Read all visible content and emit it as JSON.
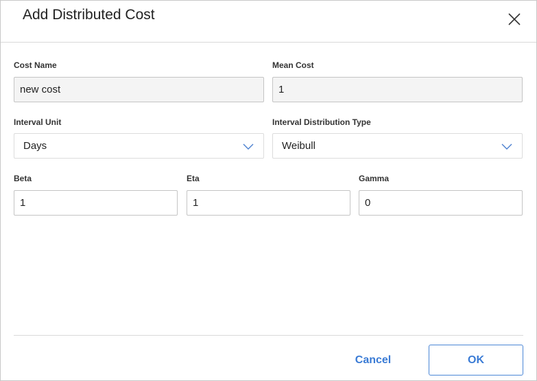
{
  "dialog": {
    "title": "Add Distributed Cost"
  },
  "fields": {
    "cost_name": {
      "label": "Cost Name",
      "value": "new cost"
    },
    "mean_cost": {
      "label": "Mean Cost",
      "value": "1"
    },
    "interval_unit": {
      "label": "Interval Unit",
      "value": "Days"
    },
    "interval_distribution_type": {
      "label": "Interval Distribution Type",
      "value": "Weibull"
    },
    "beta": {
      "label": "Beta",
      "value": "1"
    },
    "eta": {
      "label": "Eta",
      "value": "1"
    },
    "gamma": {
      "label": "Gamma",
      "value": "0"
    }
  },
  "footer": {
    "cancel_label": "Cancel",
    "ok_label": "OK"
  },
  "icons": {
    "close": "close-icon",
    "chevron": "chevron-down-icon"
  },
  "colors": {
    "accent": "#3a7bd5",
    "chevron": "#4a7fcf"
  }
}
